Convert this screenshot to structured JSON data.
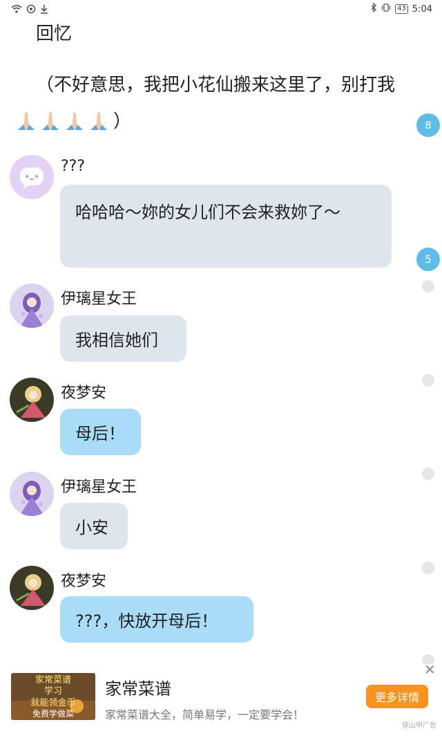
{
  "status_bar": {
    "time": "5:04",
    "battery": "43",
    "left_icons": [
      "wifi-icon",
      "data-saver-icon",
      "download-icon"
    ],
    "right_icons": [
      "bluetooth-icon",
      "vibrate-icon"
    ]
  },
  "intro": {
    "line1": "回忆",
    "line2": "（不好意思，我把小花仙搬来这里了，别打我",
    "line3_suffix": "）",
    "emoji": "pray-hands-icon"
  },
  "badges": [
    "8",
    "5"
  ],
  "messages": [
    {
      "sender": "???",
      "text": "哈哈哈～妳的女儿们不会来救妳了～",
      "style": "gray"
    },
    {
      "sender": "伊璃星女王",
      "text": "我相信她们",
      "style": "gray"
    },
    {
      "sender": "夜梦安",
      "text": "母后！",
      "style": "blue"
    },
    {
      "sender": "伊璃星女王",
      "text": "小安",
      "style": "gray"
    },
    {
      "sender": "夜梦安",
      "text": "???，快放开母后！",
      "style": "blue"
    }
  ],
  "ad": {
    "thumb_text": [
      "家常菜谱",
      "学习",
      "就能领金币",
      "免费学做菜"
    ],
    "title": "家常菜谱",
    "description": "家常菜谱大全，简单易学，一定要学会！",
    "button": "更多详情",
    "label": "穿山甲广告",
    "close": "✕"
  },
  "colors": {
    "badge": "#5ebde8",
    "bubble_gray": "#dfe5ed",
    "bubble_blue": "#a8dcf7",
    "ad_button": "#f7931e"
  }
}
